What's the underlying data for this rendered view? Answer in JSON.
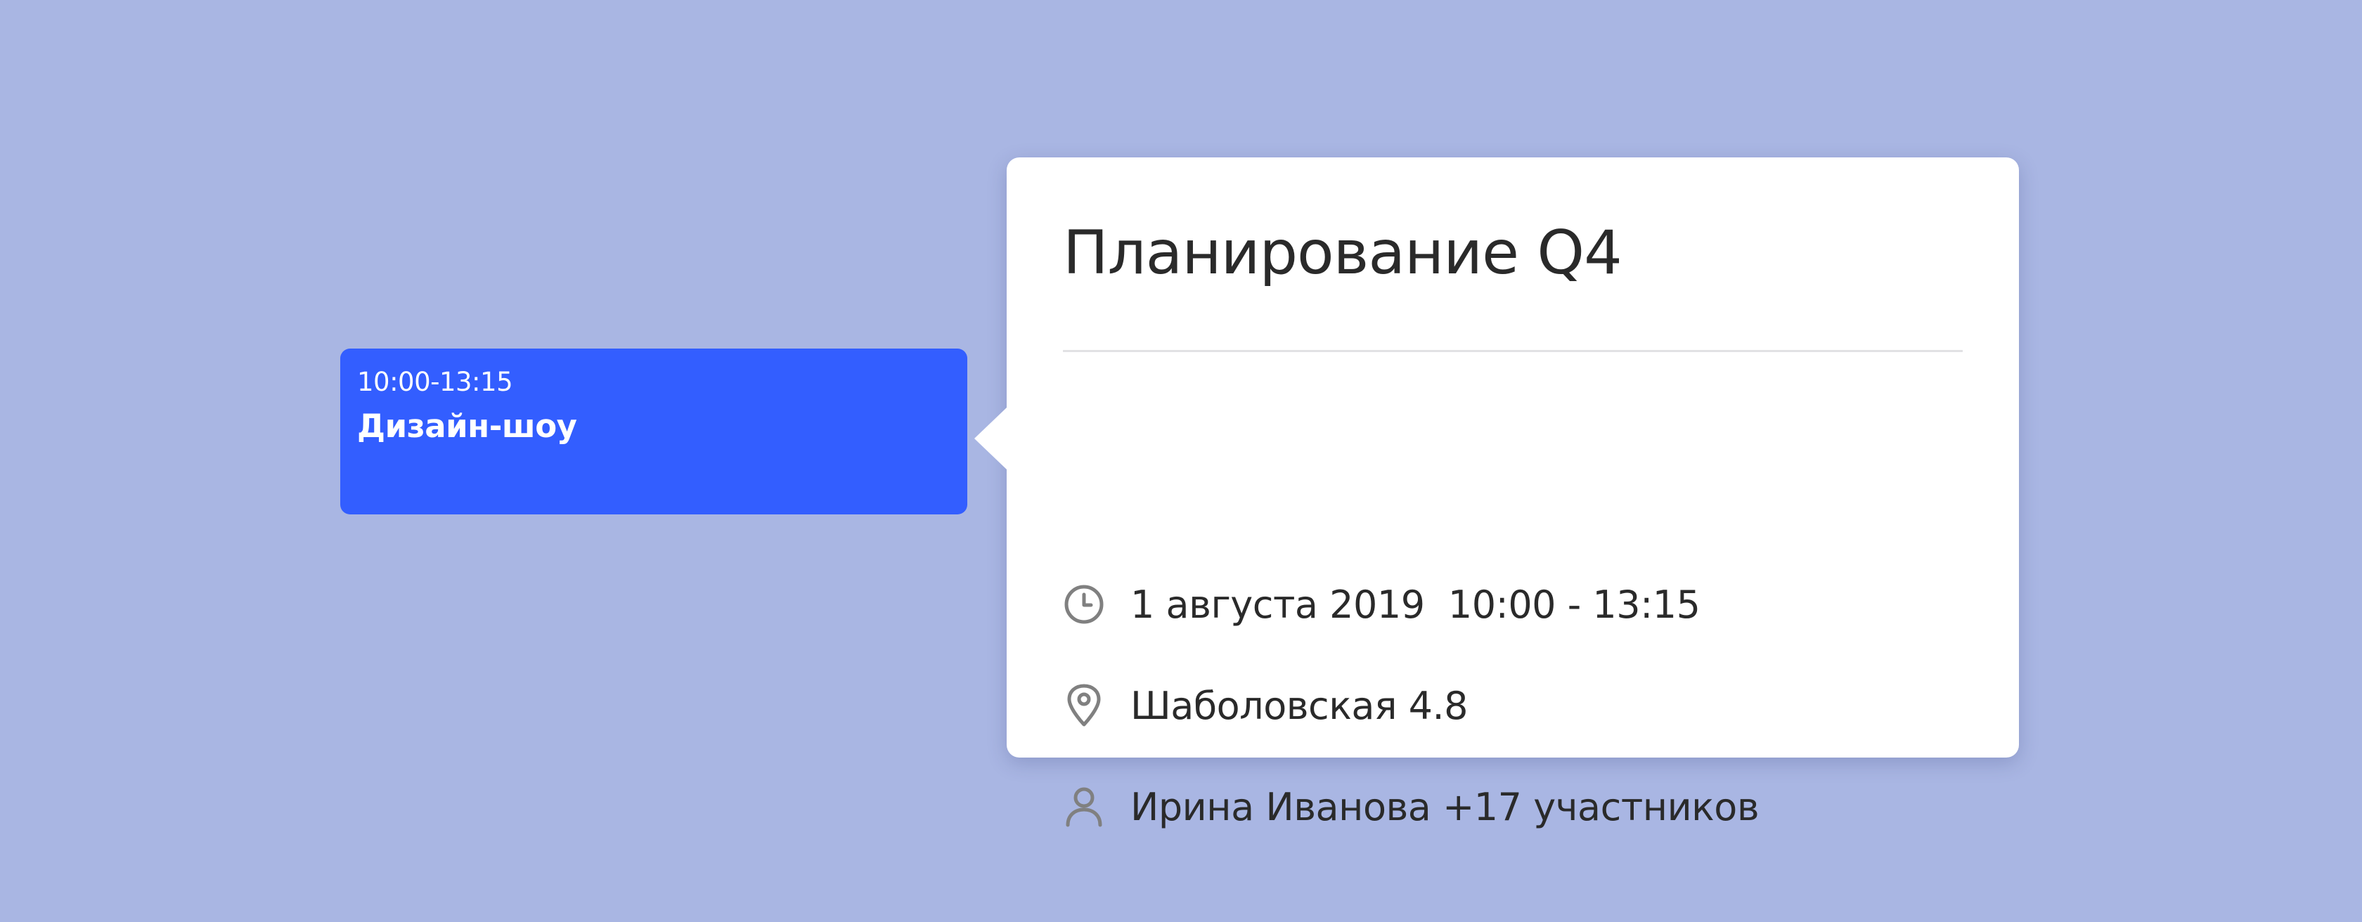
{
  "event_block": {
    "time": "10:00-13:15",
    "title": "Дизайн-шоу"
  },
  "popover": {
    "title": "Планирование Q4",
    "details": {
      "datetime": "1 августа 2019  10:00 - 13:15",
      "location": "Шаболовская 4.8",
      "participants": "Ирина Иванова +17 участников"
    },
    "icons": {
      "datetime": "clock-icon",
      "location": "location-pin-icon",
      "participants": "person-icon"
    }
  },
  "colors": {
    "background": "#a9b6e3",
    "event_accent": "#335eff",
    "card": "#ffffff",
    "text_primary": "#2a2a2a",
    "icon_gray": "#808080",
    "divider": "#e1e1e4"
  }
}
